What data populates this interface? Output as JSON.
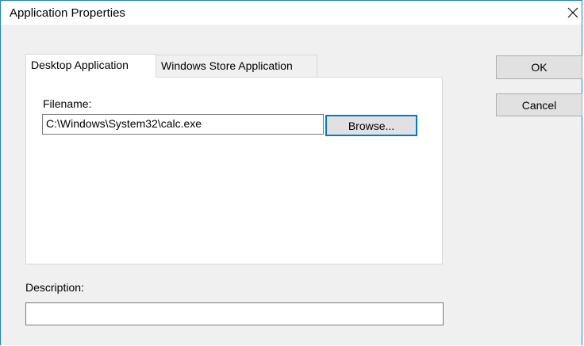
{
  "window": {
    "title": "Application Properties"
  },
  "tabs": [
    {
      "label": "Desktop Application",
      "active": true
    },
    {
      "label": "Windows Store Application",
      "active": false
    }
  ],
  "desktop_tab": {
    "filename_label": "Filename:",
    "filename_value": "C:\\Windows\\System32\\calc.exe",
    "browse_label": "Browse..."
  },
  "description": {
    "label": "Description:",
    "value": ""
  },
  "buttons": {
    "ok_label": "OK",
    "cancel_label": "Cancel"
  },
  "icons": {
    "close": "close-icon"
  },
  "colors": {
    "window_border": "#1883d7",
    "dialog_background": "#f0f0f0",
    "default_button_border": "#0078d7"
  }
}
